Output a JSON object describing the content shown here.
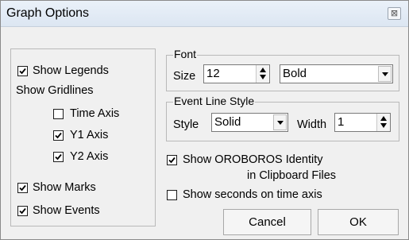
{
  "window": {
    "title": "Graph Options",
    "close_glyph": "⊠"
  },
  "left": {
    "show_legends": {
      "label": "Show Legends",
      "checked": true
    },
    "gridlines_title": "Show Gridlines",
    "time_axis": {
      "label": "Time Axis",
      "checked": false
    },
    "y1_axis": {
      "label": "Y1 Axis",
      "checked": true
    },
    "y2_axis": {
      "label": "Y2 Axis",
      "checked": true
    },
    "show_marks": {
      "label": "Show Marks",
      "checked": true
    },
    "show_events": {
      "label": "Show Events",
      "checked": true
    }
  },
  "font_group": {
    "title": "Font",
    "size_label": "Size",
    "size_value": "12",
    "style_value": "Bold"
  },
  "event_group": {
    "title": "Event Line Style",
    "style_label": "Style",
    "style_value": "Solid",
    "width_label": "Width",
    "width_value": "1"
  },
  "options": {
    "identity_line1": "Show OROBOROS Identity",
    "identity_line2": "in Clipboard Files",
    "identity_checked": true,
    "seconds_label": "Show seconds on time axis",
    "seconds_checked": false
  },
  "buttons": {
    "cancel": "Cancel",
    "ok": "OK"
  },
  "icons": {
    "close": "close-icon",
    "check": "checkmark-icon",
    "spin": "spinner-arrows-icon",
    "dropdown": "chevron-down-icon"
  }
}
